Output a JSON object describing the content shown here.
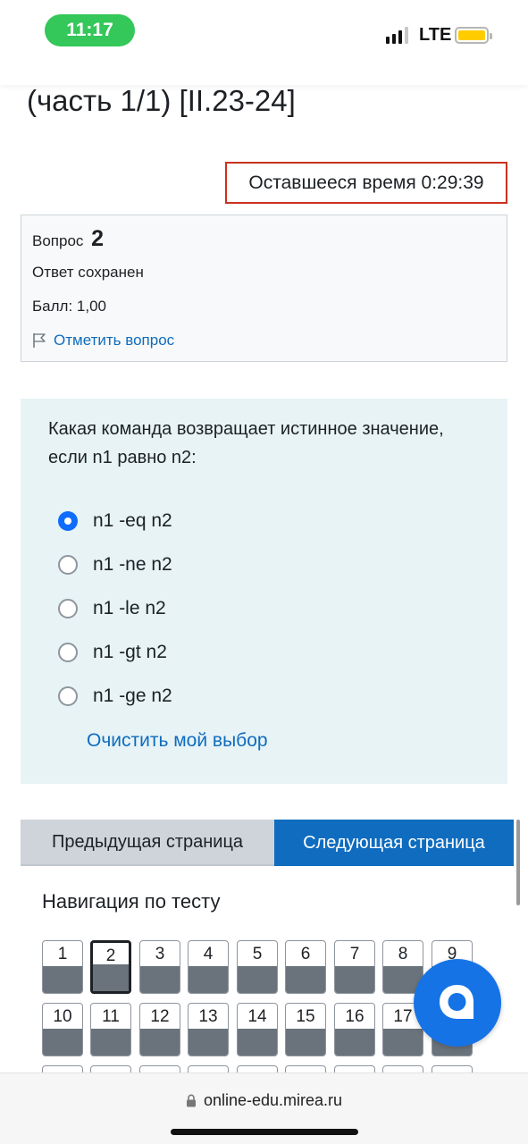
{
  "status_bar": {
    "time": "11:17",
    "network": "LTE",
    "signal_bars": 4,
    "signal_bars_filled": 3,
    "battery_level": 1.0,
    "colors": {
      "time_pill": "#34c759",
      "battery": "#ffcc00"
    }
  },
  "header": {
    "title": "(часть 1/1) [II.23-24]"
  },
  "timer": {
    "text": "Оставшееся время 0:29:39"
  },
  "question_info": {
    "label": "Вопрос",
    "number": "2",
    "state": "Ответ сохранен",
    "grade": "Балл: 1,00",
    "flag_label": "Отметить вопрос",
    "flag_icon": "flag-icon"
  },
  "question": {
    "text": "Какая команда возвращает истинное значение, если n1 равно n2:",
    "answers": [
      {
        "label": "n1 -eq n2",
        "selected": true
      },
      {
        "label": "n1 -ne n2",
        "selected": false
      },
      {
        "label": "n1 -le n2",
        "selected": false
      },
      {
        "label": "n1 -gt n2",
        "selected": false
      },
      {
        "label": "n1 -ge n2",
        "selected": false
      }
    ],
    "clear_label": "Очистить мой выбор"
  },
  "navigation_buttons": {
    "prev_label": "Предыдущая страница",
    "next_label": "Следующая страница"
  },
  "quiz_navigation": {
    "heading": "Навигация по тесту",
    "current": "2",
    "rows": [
      [
        "1",
        "2",
        "3",
        "4",
        "5",
        "6",
        "7",
        "8",
        "9"
      ],
      [
        "10",
        "11",
        "12",
        "13",
        "14",
        "15",
        "16",
        "17",
        ""
      ]
    ]
  },
  "chat": {
    "icon": "chat-bubble-icon"
  },
  "browser": {
    "url": "online-edu.mirea.ru",
    "lock_icon": "lock-icon"
  },
  "colors": {
    "accent": "#0f6cbf",
    "timer_border": "#ca3120",
    "question_bg": "#e7f3f5",
    "nav_bar": "#6a737b"
  }
}
